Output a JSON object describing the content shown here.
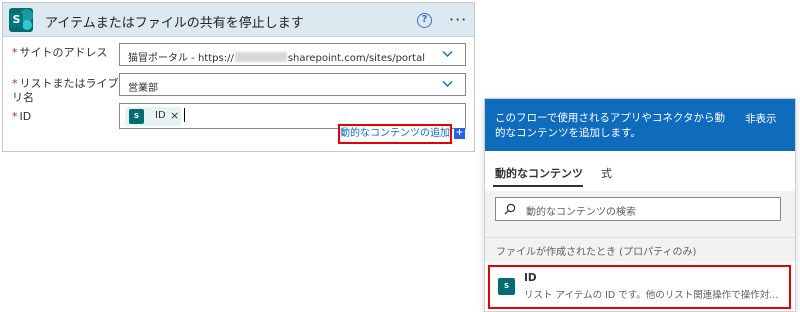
{
  "action": {
    "title": "アイテムまたはファイルの共有を停止します",
    "help_symbol": "?",
    "more_symbol": "···",
    "fields": [
      {
        "required_mark": "*",
        "label": "サイトのアドレス",
        "value_prefix": "猫冒ポータル - https://",
        "value_suffix": "sharepoint.com/sites/portal"
      },
      {
        "required_mark": "*",
        "label_line1": "リストまたはライブラ",
        "label_line2": "リ名",
        "value": "営業部"
      },
      {
        "required_mark": "*",
        "label": "ID",
        "token_label": "ID",
        "token_close": "×"
      }
    ],
    "add_dynamic_link": "動的なコンテンツの追加",
    "add_plus": "+"
  },
  "panel": {
    "description": "このフローで使用されるアプリやコネクタから動的なコンテンツを追加します。",
    "hide_label": "非表示",
    "tabs": [
      {
        "label": "動的なコンテンツ",
        "active": true
      },
      {
        "label": "式",
        "active": false
      }
    ],
    "search_placeholder": "動的なコンテンツの検索",
    "section_title": "ファイルが作成されたとき (プロパティのみ)",
    "items": [
      {
        "name": "ID",
        "description": "リスト アイテムの ID です。他のリスト関連操作で操作対..."
      }
    ]
  },
  "icons": {
    "sharepoint": "sharepoint-icon",
    "help": "help-circle-icon",
    "more": "more-horizontal-icon",
    "dropdown": "chevron-down-icon",
    "search": "search-icon"
  },
  "colors": {
    "header_bg": "#dce9f1",
    "accent_blue": "#0f6cbd",
    "highlight_red": "#e20000",
    "sharepoint_teal": "#036c70"
  }
}
